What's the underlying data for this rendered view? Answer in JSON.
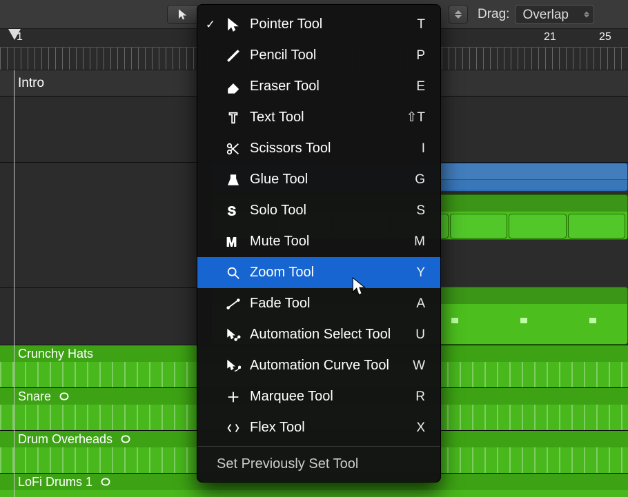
{
  "toolbar": {
    "drag_label": "Drag:",
    "drag_value": "Overlap"
  },
  "ruler": {
    "labels": [
      {
        "pos": 24,
        "text": "1"
      },
      {
        "pos": 788,
        "text": "21"
      },
      {
        "pos": 868,
        "text": "25"
      }
    ]
  },
  "marker": {
    "name": "Intro"
  },
  "tracks": {
    "crunchy": "Crunchy Hats",
    "snare": "Snare",
    "overheads": "Drum Overheads",
    "lofi": "LoFi Drums 1"
  },
  "menu": {
    "items": [
      {
        "key": "pointer",
        "label": "Pointer Tool",
        "shortcut": "T",
        "checked": true,
        "icon": "pointer-icon"
      },
      {
        "key": "pencil",
        "label": "Pencil Tool",
        "shortcut": "P",
        "checked": false,
        "icon": "pencil-icon"
      },
      {
        "key": "eraser",
        "label": "Eraser Tool",
        "shortcut": "E",
        "checked": false,
        "icon": "eraser-icon"
      },
      {
        "key": "text",
        "label": "Text Tool",
        "shortcut": "⇧T",
        "checked": false,
        "icon": "text-icon"
      },
      {
        "key": "scissors",
        "label": "Scissors Tool",
        "shortcut": "I",
        "checked": false,
        "icon": "scissors-icon"
      },
      {
        "key": "glue",
        "label": "Glue Tool",
        "shortcut": "G",
        "checked": false,
        "icon": "glue-icon"
      },
      {
        "key": "solo",
        "label": "Solo Tool",
        "shortcut": "S",
        "checked": false,
        "icon": "solo-icon"
      },
      {
        "key": "mute",
        "label": "Mute Tool",
        "shortcut": "M",
        "checked": false,
        "icon": "mute-icon"
      },
      {
        "key": "zoom",
        "label": "Zoom Tool",
        "shortcut": "Y",
        "checked": false,
        "icon": "zoom-icon",
        "selected": true
      },
      {
        "key": "fade",
        "label": "Fade Tool",
        "shortcut": "A",
        "checked": false,
        "icon": "fade-icon"
      },
      {
        "key": "autosel",
        "label": "Automation Select Tool",
        "shortcut": "U",
        "checked": false,
        "icon": "automation-select-icon"
      },
      {
        "key": "autocurve",
        "label": "Automation Curve Tool",
        "shortcut": "W",
        "checked": false,
        "icon": "automation-curve-icon"
      },
      {
        "key": "marquee",
        "label": "Marquee Tool",
        "shortcut": "R",
        "checked": false,
        "icon": "marquee-icon"
      },
      {
        "key": "flex",
        "label": "Flex Tool",
        "shortcut": "X",
        "checked": false,
        "icon": "flex-icon"
      }
    ],
    "bottom": "Set Previously Set Tool"
  }
}
